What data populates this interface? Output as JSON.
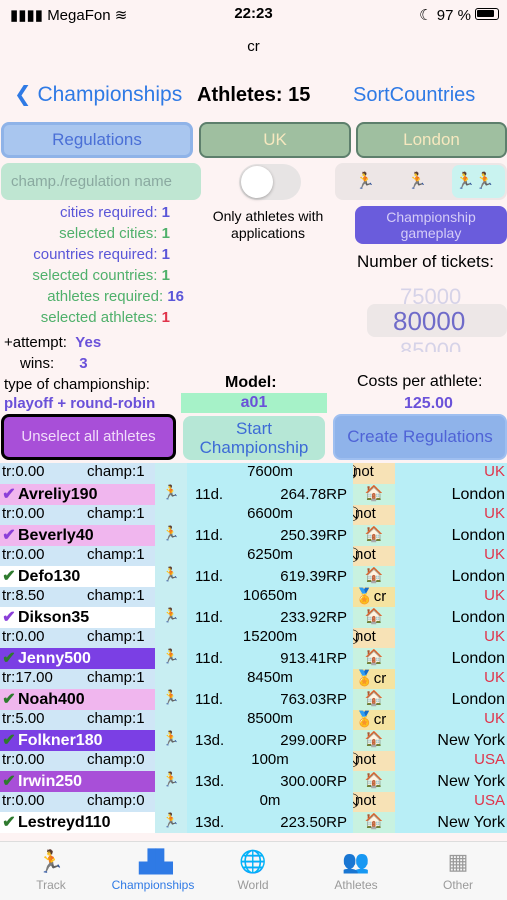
{
  "status_bar": {
    "carrier": "MegaFon",
    "time": "22:23",
    "battery": "97 %"
  },
  "subtitle": "cr",
  "nav": {
    "back_label": "Championships",
    "title": "Athletes: 15",
    "right_label": "SortCountries"
  },
  "filters": {
    "regulations": "Regulations",
    "country": "UK",
    "city": "London"
  },
  "search": {
    "placeholder": "champ./regulation name"
  },
  "only_apps_label": "Only athletes with applications",
  "gameplay_button": "Championship gameplay",
  "stats": [
    {
      "label": "cities required:",
      "value": "1",
      "color": "#5a56d8"
    },
    {
      "label": "selected cities:",
      "value": "1",
      "color": "#4fb06b"
    },
    {
      "label": "countries required:",
      "value": "1",
      "color": "#5a56d8"
    },
    {
      "label": "selected countries:",
      "value": "1",
      "color": "#4fb06b"
    },
    {
      "label": "athletes required:",
      "value": "16",
      "color": "#5a56d8"
    },
    {
      "label": "selected athletes:",
      "value": "1",
      "color": "#e0334a"
    }
  ],
  "tickets": {
    "label": "Number of tickets:",
    "prev": "75000",
    "value": "80000",
    "next": "85000"
  },
  "attempt": {
    "label": "+attempt:",
    "value": "Yes"
  },
  "wins": {
    "label": "wins:",
    "value": "3"
  },
  "type": {
    "label": "type of championship:",
    "value": "playoff + round-robin"
  },
  "model": {
    "label": "Model:",
    "value": "a01"
  },
  "cost": {
    "label": "Costs per athlete:",
    "value": "125.00"
  },
  "actions": {
    "unselect": "Unselect all athletes",
    "start": "Start Championship",
    "create": "Create Regulations"
  },
  "header_row": {
    "tr": "tr:0.00",
    "champ": "champ:1",
    "distance": "7600m",
    "status": "not",
    "country": "UK"
  },
  "athletes": [
    {
      "name": "Avreliy190",
      "check_color": "#8a3fd8",
      "name_bg": "#f0b6ee",
      "days": "11d.",
      "rp": "264.78RP",
      "city": "London",
      "tr": "tr:0.00",
      "champ": "champ:1",
      "distance": "6600m",
      "status": "not",
      "country": "UK"
    },
    {
      "name": "Beverly40",
      "check_color": "#8a3fd8",
      "name_bg": "#f0b6ee",
      "days": "11d.",
      "rp": "250.39RP",
      "city": "London",
      "tr": "tr:0.00",
      "champ": "champ:1",
      "distance": "6250m",
      "status": "not",
      "country": "UK"
    },
    {
      "name": "Defo130",
      "check_color": "#2e7a2e",
      "name_bg": "#ffffff",
      "days": "11d.",
      "rp": "619.39RP",
      "city": "London",
      "tr": "tr:8.50",
      "champ": "champ:1",
      "distance": "10650m",
      "status": "cr",
      "country": "UK"
    },
    {
      "name": "Dikson35",
      "check_color": "#8a3fd8",
      "name_bg": "#ffffff",
      "days": "11d.",
      "rp": "233.92RP",
      "city": "London",
      "tr": "tr:0.00",
      "champ": "champ:1",
      "distance": "15200m",
      "status": "not",
      "country": "UK"
    },
    {
      "name": "Jenny500",
      "check_color": "#2e7a2e",
      "name_bg": "#7b3fe4",
      "days": "11d.",
      "rp": "913.41RP",
      "city": "London",
      "tr": "tr:17.00",
      "champ": "champ:1",
      "distance": "8450m",
      "status": "cr",
      "country": "UK"
    },
    {
      "name": "Noah400",
      "check_color": "#2e7a2e",
      "name_bg": "#f0b6ee",
      "days": "11d.",
      "rp": "763.03RP",
      "city": "London",
      "tr": "tr:5.00",
      "champ": "champ:1",
      "distance": "8500m",
      "status": "cr",
      "country": "UK"
    },
    {
      "name": "Folkner180",
      "check_color": "#2e7a2e",
      "name_bg": "#7b3fe4",
      "days": "13d.",
      "rp": "299.00RP",
      "city": "New York",
      "tr": "tr:0.00",
      "champ": "champ:0",
      "distance": "100m",
      "status": "not",
      "country": "USA"
    },
    {
      "name": "Irwin250",
      "check_color": "#2e7a2e",
      "name_bg": "#a84fd8",
      "days": "13d.",
      "rp": "300.00RP",
      "city": "New York",
      "tr": "tr:0.00",
      "champ": "champ:0",
      "distance": "0m",
      "status": "not",
      "country": "USA"
    },
    {
      "name": "Lestreyd110",
      "check_color": "#2e7a2e",
      "name_bg": "#ffffff",
      "days": "13d.",
      "rp": "223.50RP",
      "city": "New York",
      "tr": "",
      "champ": "",
      "distance": "",
      "status": "",
      "country": ""
    }
  ],
  "tabs": [
    {
      "label": "Track",
      "icon": "runner-icon"
    },
    {
      "label": "Championships",
      "icon": "podium-icon"
    },
    {
      "label": "World",
      "icon": "globe-icon"
    },
    {
      "label": "Athletes",
      "icon": "athletes-icon"
    },
    {
      "label": "Other",
      "icon": "grid-icon"
    }
  ],
  "colors": {
    "accent": "#2f7ae5",
    "purple": "#6a51d9",
    "uk_red": "#e0334a"
  }
}
